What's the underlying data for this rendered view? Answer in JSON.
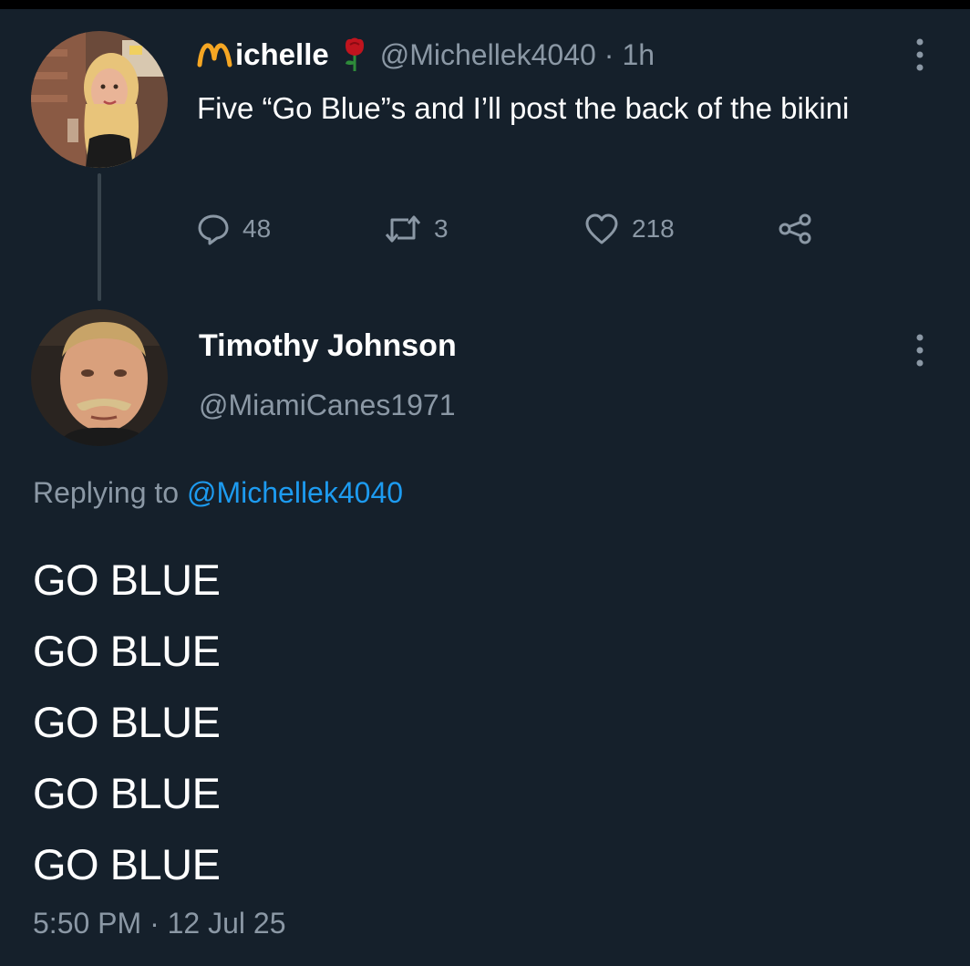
{
  "original_tweet": {
    "display_name": "ichelle",
    "handle": "@Michellek4040",
    "separator": "·",
    "time_ago": "1h",
    "text": "Five “Go Blue”s and I’ll post the back of the bikini",
    "actions": {
      "replies": "48",
      "retweets": "3",
      "likes": "218"
    }
  },
  "reply_tweet": {
    "display_name": "Timothy Johnson",
    "handle": "@MiamiCanes1971",
    "replying_prefix": "Replying to",
    "replying_to": "@Michellek4040",
    "lines": [
      "GO BLUE",
      "GO BLUE",
      "GO BLUE",
      "GO BLUE",
      "GO BLUE"
    ],
    "timestamp": "5:50 PM · 12 Jul 25"
  },
  "colors": {
    "background": "#15202b",
    "primary_text": "#ffffff",
    "secondary_text": "#8b98a5",
    "link": "#1d9bf0",
    "name_emoji_m": "#f5a623",
    "rose": "#c0141e"
  },
  "icons": [
    "m-letter-emoji",
    "rose-icon",
    "more-icon",
    "reply-icon",
    "retweet-icon",
    "like-icon",
    "share-icon"
  ]
}
